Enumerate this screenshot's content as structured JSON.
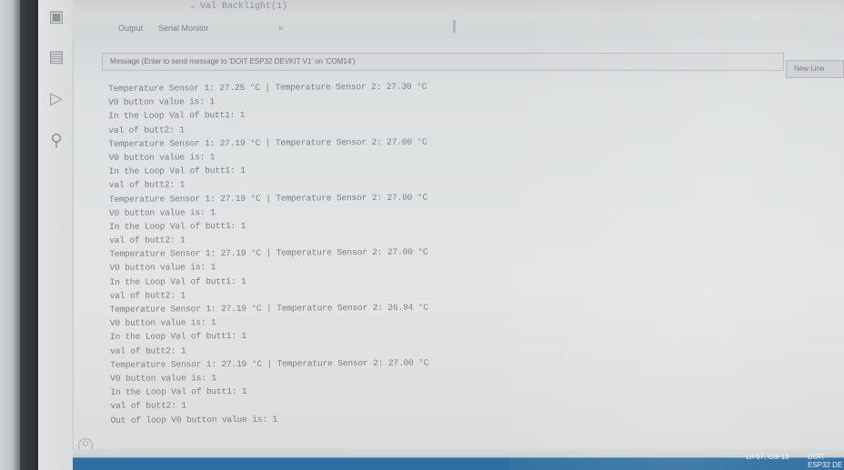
{
  "top": {
    "code_line": "→     Val Backlight(1)"
  },
  "tabs": [
    {
      "label": "Output"
    },
    {
      "label": "Serial Monitor"
    }
  ],
  "tab_close": "×",
  "message_input": {
    "placeholder": "Message (Enter to send message to 'DOIT ESP32 DEVKIT V1' on 'COM14')"
  },
  "line_ending": {
    "selected": "New Line"
  },
  "output_lines": [
    "Temperature Sensor 1: 27.25 °C | Temperature Sensor 2: 27.30 °C",
    "V0 button value is: 1",
    "In the Loop Val of butt1: 1",
    "val of butt2: 1",
    "Temperature Sensor 1: 27.19 °C | Temperature Sensor 2: 27.00 °C",
    "V0 button value is: 1",
    "In the Loop Val of butt1: 1",
    "val of butt2: 1",
    "Temperature Sensor 1: 27.19 °C | Temperature Sensor 2: 27.00 °C",
    "V0 button value is: 1",
    "In the Loop Val of butt1: 1",
    "val of butt2: 1",
    "Temperature Sensor 1: 27.19 °C | Temperature Sensor 2: 27.00 °C",
    "V0 button value is: 1",
    "In the Loop Val of butt1: 1",
    "val of butt2: 1",
    "Temperature Sensor 1: 27.19 °C | Temperature Sensor 2: 26.94 °C",
    "V0 button value is: 1",
    "In the Loop Val of butt1: 1",
    "val of butt2: 1",
    "Temperature Sensor 1: 27.19 °C | Temperature Sensor 2: 27.00 °C",
    "V0 button value is: 1",
    "In the Loop Val of butt1: 1",
    "val of butt2: 1",
    "Out of loop V0 button value is: 1"
  ],
  "status": {
    "position": "Ln 67, Col 13",
    "board": "DOIT ESP32 DE"
  },
  "icons": {
    "board": "board-icon",
    "library": "library-icon",
    "debug": "debug-icon",
    "search": "search-icon",
    "account": "account-icon"
  }
}
